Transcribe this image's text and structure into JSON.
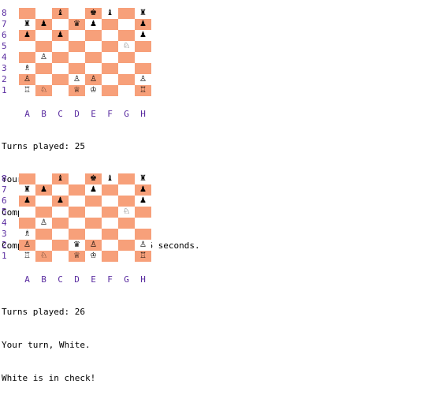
{
  "colors": {
    "dark_square": "#f7a07a",
    "light_square": "#ffffff",
    "label": "#5a2ca0"
  },
  "ranks": [
    "8",
    "7",
    "6",
    "5",
    "4",
    "3",
    "2",
    "1"
  ],
  "files": [
    "A",
    "B",
    "C",
    "D",
    "E",
    "F",
    "G",
    "H"
  ],
  "board1": [
    [
      "",
      "",
      "♝",
      "",
      "♚",
      "♝",
      "",
      "♜"
    ],
    [
      "♜",
      "♟",
      "",
      "♛",
      "♟",
      "",
      "",
      "♟"
    ],
    [
      "♟",
      "",
      "♟",
      "",
      "",
      "",
      "",
      "♟"
    ],
    [
      "",
      "",
      "",
      "",
      "",
      "",
      "♘",
      ""
    ],
    [
      "",
      "♙",
      "",
      "",
      "",
      "",
      "",
      ""
    ],
    [
      "♗",
      "",
      "",
      "",
      "",
      "",
      "",
      ""
    ],
    [
      "♙",
      "",
      "",
      "♙",
      "♙",
      "",
      "",
      "♙"
    ],
    [
      "♖",
      "♘",
      "",
      "♕",
      "♔",
      "",
      "",
      "♖"
    ]
  ],
  "board2": [
    [
      "",
      "",
      "♝",
      "",
      "♚",
      "♝",
      "",
      "♜"
    ],
    [
      "♜",
      "♟",
      "",
      "",
      "♟",
      "",
      "",
      "♟"
    ],
    [
      "♟",
      "",
      "♟",
      "",
      "",
      "",
      "",
      "♟"
    ],
    [
      "",
      "",
      "",
      "",
      "",
      "",
      "♘",
      ""
    ],
    [
      "",
      "♙",
      "",
      "",
      "",
      "",
      "",
      ""
    ],
    [
      "♗",
      "",
      "",
      "",
      "",
      "",
      "",
      ""
    ],
    [
      "♙",
      "",
      "",
      "♛",
      "♙",
      "",
      "",
      "♙"
    ],
    [
      "♖",
      "♘",
      "",
      "♕",
      "♔",
      "",
      "",
      "♖"
    ]
  ],
  "log1": {
    "turns": "Turns played: 25",
    "turn": "Your turn, Black.",
    "thinking": "Computer is thinking...",
    "thought": "Computer thought for 1.345006 seconds."
  },
  "log2": {
    "turns": "Turns played: 26",
    "turn": "Your turn, White.",
    "check": "White is in check!"
  }
}
